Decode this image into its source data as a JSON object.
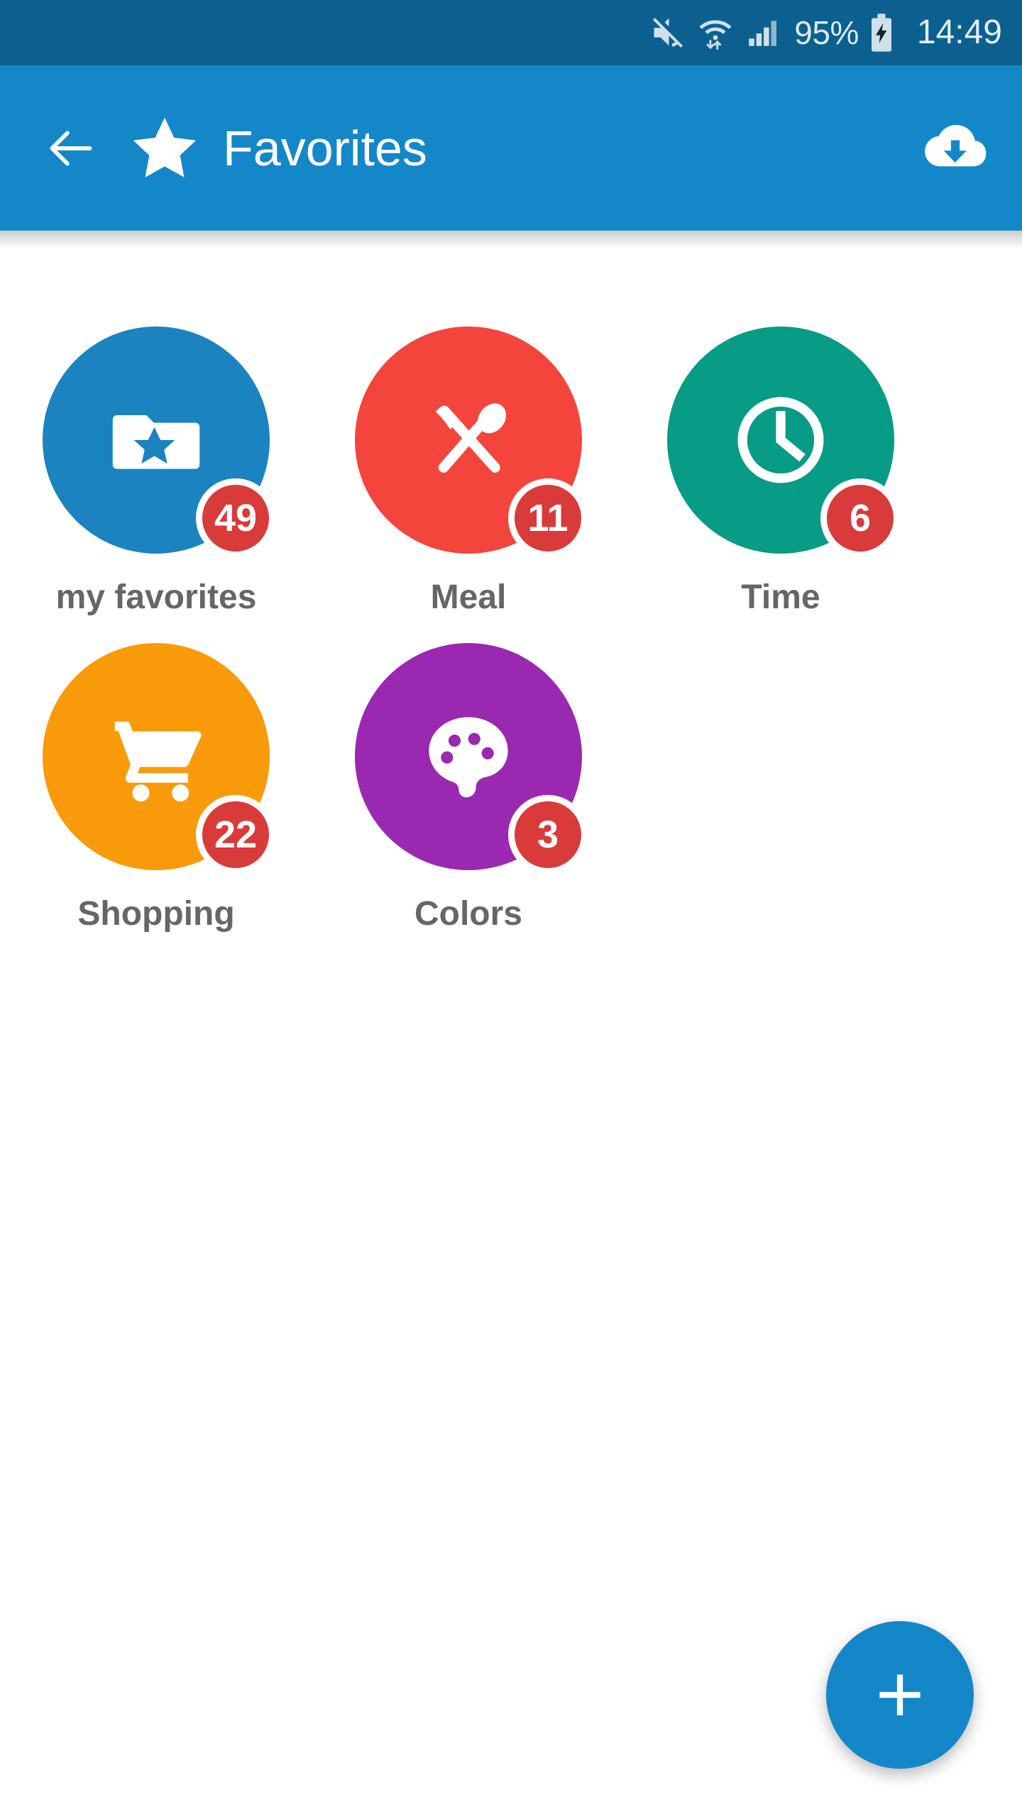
{
  "status_bar": {
    "background": "#0b608f",
    "battery_percent": "95%",
    "clock": "14:49",
    "icons": [
      "mute-icon",
      "wifi-transfer-icon",
      "cellular-signal-icon",
      "battery-charging-icon"
    ]
  },
  "app_bar": {
    "background": "#1487c9",
    "title": "Favorites",
    "back_icon": "arrow-left-icon",
    "brand_icon": "star-icon",
    "action_icon": "cloud-download-icon"
  },
  "categories": [
    {
      "label": "my favorites",
      "badge": "49",
      "color": "#1a83c0",
      "icon": "folder-star-icon"
    },
    {
      "label": "Meal",
      "badge": "11",
      "color": "#f4453c",
      "icon": "fork-spoon-icon"
    },
    {
      "label": "Time",
      "badge": "6",
      "color": "#089b85",
      "icon": "clock-icon"
    },
    {
      "label": "Shopping",
      "badge": "22",
      "color": "#f99a0b",
      "icon": "shopping-cart-icon"
    },
    {
      "label": "Colors",
      "badge": "3",
      "color": "#9a28b0",
      "icon": "palette-icon"
    }
  ],
  "fab": {
    "label": "+",
    "icon": "plus-icon",
    "color": "#1487c9"
  },
  "theme": {
    "badge_color": "#d93a3a",
    "label_color": "#666666",
    "page_background": "#ffffff"
  }
}
